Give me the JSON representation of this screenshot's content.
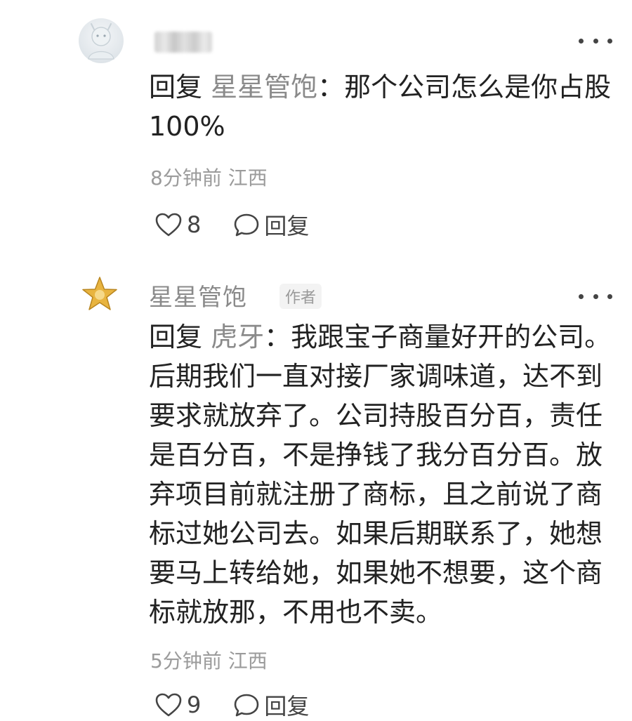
{
  "comments": [
    {
      "username": "",
      "author_badge": "",
      "reply_prefix": "回复",
      "reply_target": "星星管饱",
      "separator": "：",
      "content": "那个公司怎么是你占股100%",
      "time": "8分钟前",
      "location": "江西",
      "likes": "8",
      "reply_label": "回复"
    },
    {
      "username": "星星管饱",
      "author_badge": "作者",
      "reply_prefix": "回复",
      "reply_target": "虎牙",
      "separator": "：",
      "content": "我跟宝子商量好开的公司。后期我们一直对接厂家调味道，达不到要求就放弃了。公司持股百分百，责任是百分百，不是挣钱了我分百分百。放弃项目前就注册了商标，且之前说了商标过她公司去。如果后期联系了，她想要马上转给她，如果她不想要，这个商标就放那，不用也不卖。",
      "time": "5分钟前",
      "location": "江西",
      "likes": "9",
      "reply_label": "回复"
    }
  ],
  "icons": {
    "like": "heart-outline-icon",
    "reply": "speech-bubble-icon",
    "more": "more-dots-icon"
  },
  "colors": {
    "text": "#222222",
    "muted": "#8a8a8a",
    "meta": "#9b9b9b",
    "star": "#e8b440"
  }
}
